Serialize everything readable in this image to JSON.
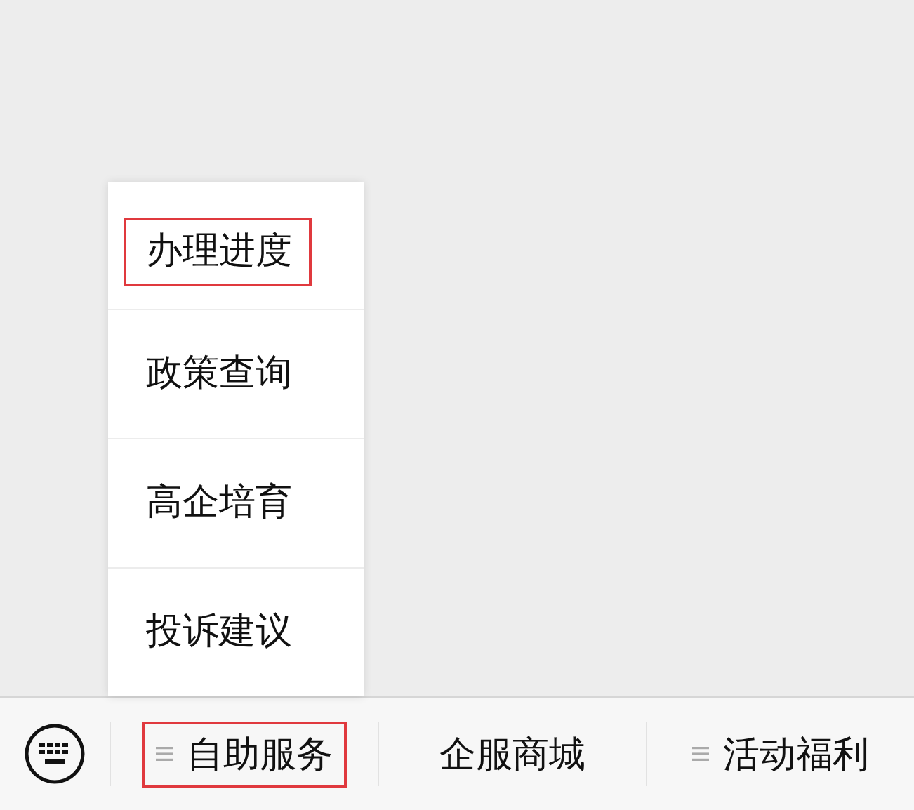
{
  "popup_menu": {
    "items": [
      {
        "label": "办理进度",
        "highlighted": true
      },
      {
        "label": "政策查询",
        "highlighted": false
      },
      {
        "label": "高企培育",
        "highlighted": false
      },
      {
        "label": "投诉建议",
        "highlighted": false
      }
    ]
  },
  "menu_bar": {
    "items": [
      {
        "label": "自助服务",
        "has_submenu": true,
        "highlighted": true
      },
      {
        "label": "企服商城",
        "has_submenu": false,
        "highlighted": false
      },
      {
        "label": "活动福利",
        "has_submenu": true,
        "highlighted": false
      }
    ]
  }
}
